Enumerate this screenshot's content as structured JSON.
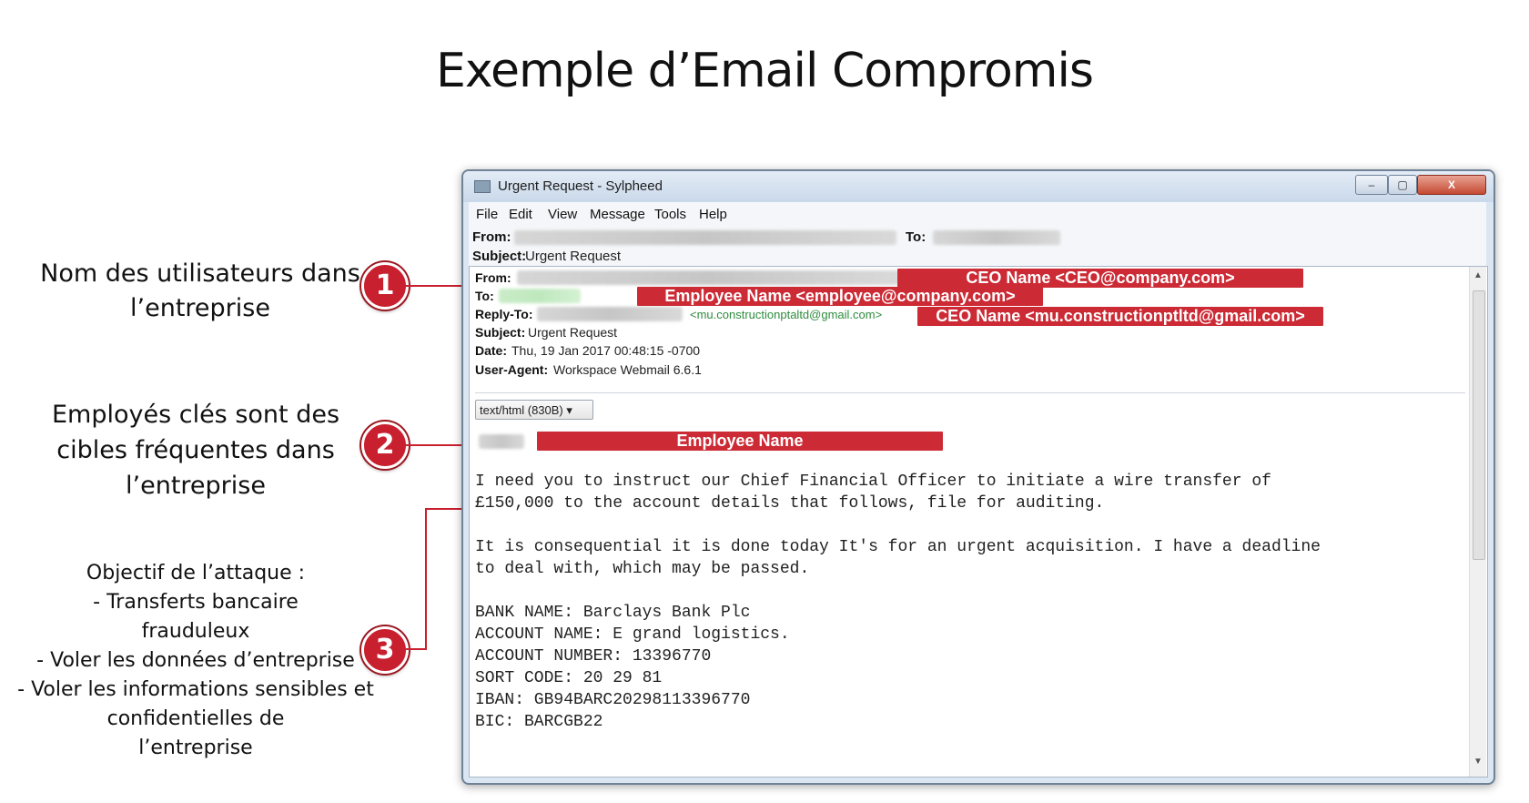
{
  "title": "Exemple d’Email Compromis",
  "callouts": [
    {
      "number": "1",
      "lines": [
        "Nom des utilisateurs dans",
        "l’entreprise"
      ]
    },
    {
      "number": "2",
      "lines": [
        "Employés clés sont des",
        "cibles fréquentes dans",
        "l’entreprise"
      ]
    },
    {
      "number": "3",
      "lines": [
        "Objectif de l’attaque :",
        "- Transferts bancaire",
        "frauduleux",
        "- Voler les données d’entreprise",
        "- Voler les informations sensibles et",
        "confidentielles de",
        "l’entreprise"
      ]
    }
  ],
  "window": {
    "title": "Urgent Request - Sylpheed",
    "controls": {
      "minimize": "–",
      "maximize": "▢",
      "close": "X"
    },
    "menu": [
      "File",
      "Edit",
      "View",
      "Message",
      "Tools",
      "Help"
    ],
    "outer_header": {
      "from_label": "From:",
      "to_label": "To:",
      "subject_label": "Subject:",
      "subject_value": "Urgent Request"
    },
    "headers": {
      "from_label": "From:",
      "to_label": "To:",
      "reply_to_label": "Reply-To:",
      "reply_to_value": "<mu.constructionptaltd@gmail.com>",
      "subject_label": "Subject:",
      "subject_value": "Urgent Request",
      "date_label": "Date:",
      "date_value": "Thu, 19 Jan 2017 00:48:15 -0700",
      "user_agent_label": "User-Agent:",
      "user_agent_value": "Workspace Webmail 6.6.1"
    },
    "mime_dropdown": "text/html (830B) ▾",
    "annotations": {
      "from": "CEO Name <CEO@company.com>",
      "to": "Employee Name <employee@company.com>",
      "reply_to": "CEO Name <mu.constructionptltd@gmail.com>",
      "greeting": "Employee Name"
    },
    "body": [
      "I need you to instruct our Chief Financial Officer to initiate a wire transfer of",
      "£150,000 to the account details that follows, file for auditing.",
      "",
      "It is consequential it is done today It's for an urgent acquisition. I have a deadline",
      "to deal with, which may be passed.",
      "",
      "BANK NAME: Barclays Bank Plc",
      "ACCOUNT NAME: E grand logistics.",
      "ACCOUNT NUMBER: 13396770",
      "SORT CODE: 20 29 81",
      "IBAN: GB94BARC20298113396770",
      "BIC: BARCGB22"
    ]
  },
  "colors": {
    "accent_red": "#c8202e",
    "annotation_red": "#cc2a35",
    "window_frame": "#dbe6f3"
  }
}
